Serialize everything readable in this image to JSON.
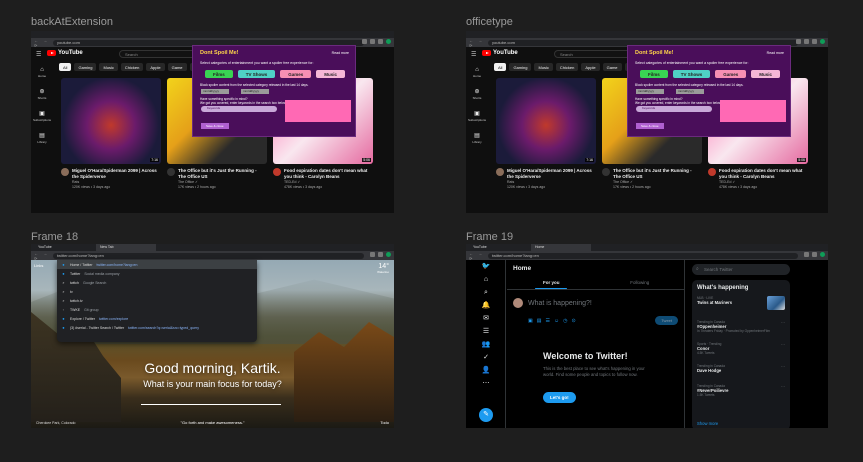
{
  "frames": {
    "f1": {
      "label": "backAtExtension",
      "url": "youtube.com"
    },
    "f2": {
      "label": "officetype",
      "url": "youtube.com"
    },
    "f3": {
      "label": "Frame 18",
      "url": "twitter.com/home?lang=en"
    },
    "f4": {
      "label": "Frame 19",
      "url": "twitter.com/home?lang=en"
    }
  },
  "youtube": {
    "logo": "YouTube",
    "search_placeholder": "Search",
    "sidebar": [
      {
        "icon": "home-icon",
        "glyph": "⌂",
        "label": "Home"
      },
      {
        "icon": "shorts-icon",
        "glyph": "⊛",
        "label": "Shorts"
      },
      {
        "icon": "subscriptions-icon",
        "glyph": "▣",
        "label": "Subscriptions"
      },
      {
        "icon": "library-icon",
        "glyph": "▤",
        "label": "Library"
      }
    ],
    "chips": [
      "All",
      "Gaming",
      "Music",
      "Chicken",
      "Apple",
      "Game",
      "Pr"
    ],
    "videos": [
      {
        "title": "Miguel O'Hara/Spiderman 2099 | Across the Spiderverse",
        "channel": "Rats",
        "meta": "120K views • 3 days ago",
        "duration": "7:16"
      },
      {
        "title": "The Office but it's Just the Running - The Office US",
        "channel": "The Office ✓",
        "meta": "17K views • 2 hours ago",
        "duration": ""
      },
      {
        "title": "Food expiration dates don't mean what you think - Carolyn Beans",
        "channel": "TED-Ed ✓",
        "meta": "478K views • 3 days ago",
        "duration": "5:06"
      }
    ],
    "shorts_label": "Shorts"
  },
  "extension": {
    "title": "Dont Spoil Me!",
    "read_more": "Read more",
    "subtitle": "Select categories of entertainment you want a spoiler free experience for:",
    "categories": [
      {
        "label": "Films",
        "color": "#39d353"
      },
      {
        "label": "TV Shows",
        "color": "#4fd1c5"
      },
      {
        "label": "Games",
        "color": "#f78fb3"
      },
      {
        "label": "Music",
        "color": "#f5b7d6"
      }
    ],
    "block_line": "Block spoiler content from the selected category released in the last 14 days.",
    "date_from": "mm/dd/yyyy",
    "date_to": "mm/dd/yyyy",
    "specific_q": "Have something specific in mind?",
    "specific_hint": "We got you covered, enter keywords in the search box below",
    "input_placeholder": "Keywords",
    "save": "Save & close"
  },
  "momentum": {
    "tabs": [
      "YouTube",
      "New Tab"
    ],
    "omnibox": "twitter.com/home?lang=en",
    "links": "Links",
    "dropdown": [
      {
        "icon": "twitter-icon",
        "text": "Home / Twitter",
        "sub": "twitter.com/home?lang=en",
        "sel": true
      },
      {
        "icon": "twitter-icon",
        "text": "Twitter",
        "sub": "Social media company",
        "sel": false
      },
      {
        "icon": "search-icon",
        "text": "twitch",
        "sub": "Google Search",
        "sel": false
      },
      {
        "icon": "search-icon",
        "text": "tv",
        "sub": "",
        "sel": false
      },
      {
        "icon": "search-icon",
        "text": "twitch.tv",
        "sub": "",
        "sel": false
      },
      {
        "icon": "page-icon",
        "text": "TWKE",
        "sub": "Git group",
        "sel": false
      },
      {
        "icon": "twitter-icon",
        "text": "Explore / Twitter",
        "sub": "twitter.com/explore",
        "sel": false
      },
      {
        "icon": "twitter-icon",
        "text": "(3) #serial - Twitter Search / Twitter",
        "sub": "twitter.com/search?q=serial&src=typed_query",
        "sel": false
      }
    ],
    "greeting": "Good morning, Kartik.",
    "focus": "What is your main focus for today?",
    "quote": "\"Go forth and make awesomeness.\"",
    "todo": "Todo",
    "location": "Cherokee Park, Colorado",
    "temp": "14°",
    "city": "Waterloo"
  },
  "twitter": {
    "home": "Home",
    "tab_for_you": "For you",
    "tab_following": "Following",
    "compose_placeholder": "What is happening?!",
    "tweet_btn": "Tweet",
    "welcome": "Welcome to Twitter!",
    "welcome_sub": "This is the best place to see what's happening in your world. Find some people and topics to follow now.",
    "lets_go": "Let's go!",
    "search_placeholder": "Search Twitter",
    "whats_happening": "What's happening",
    "trends": [
      {
        "ctx": "MLB · LIVE",
        "name": "Twins at Mariners",
        "count": ""
      },
      {
        "ctx": "Trending in Canada",
        "name": "#Oppenheimer",
        "count": "In Theaters Friday · Promoted by OppenheimerFilm"
      },
      {
        "ctx": "Sports · Trending",
        "name": "Conor",
        "count": "4.5K Tweets"
      },
      {
        "ctx": "Trending in Canada",
        "name": "Dave Hodge",
        "count": ""
      },
      {
        "ctx": "Trending in Canada",
        "name": "#NeverPoilievre",
        "count": "1.5K Tweets"
      }
    ],
    "show_more": "Show more",
    "side_icons": [
      {
        "name": "twitter-logo-icon",
        "glyph": "🐦"
      },
      {
        "name": "home-icon",
        "glyph": "⌂"
      },
      {
        "name": "explore-icon",
        "glyph": "⌕"
      },
      {
        "name": "notifications-icon",
        "glyph": "🔔"
      },
      {
        "name": "messages-icon",
        "glyph": "✉"
      },
      {
        "name": "lists-icon",
        "glyph": "☰"
      },
      {
        "name": "communities-icon",
        "glyph": "👥"
      },
      {
        "name": "verified-icon",
        "glyph": "✓"
      },
      {
        "name": "profile-icon",
        "glyph": "👤"
      },
      {
        "name": "more-icon",
        "glyph": "⋯"
      }
    ]
  }
}
